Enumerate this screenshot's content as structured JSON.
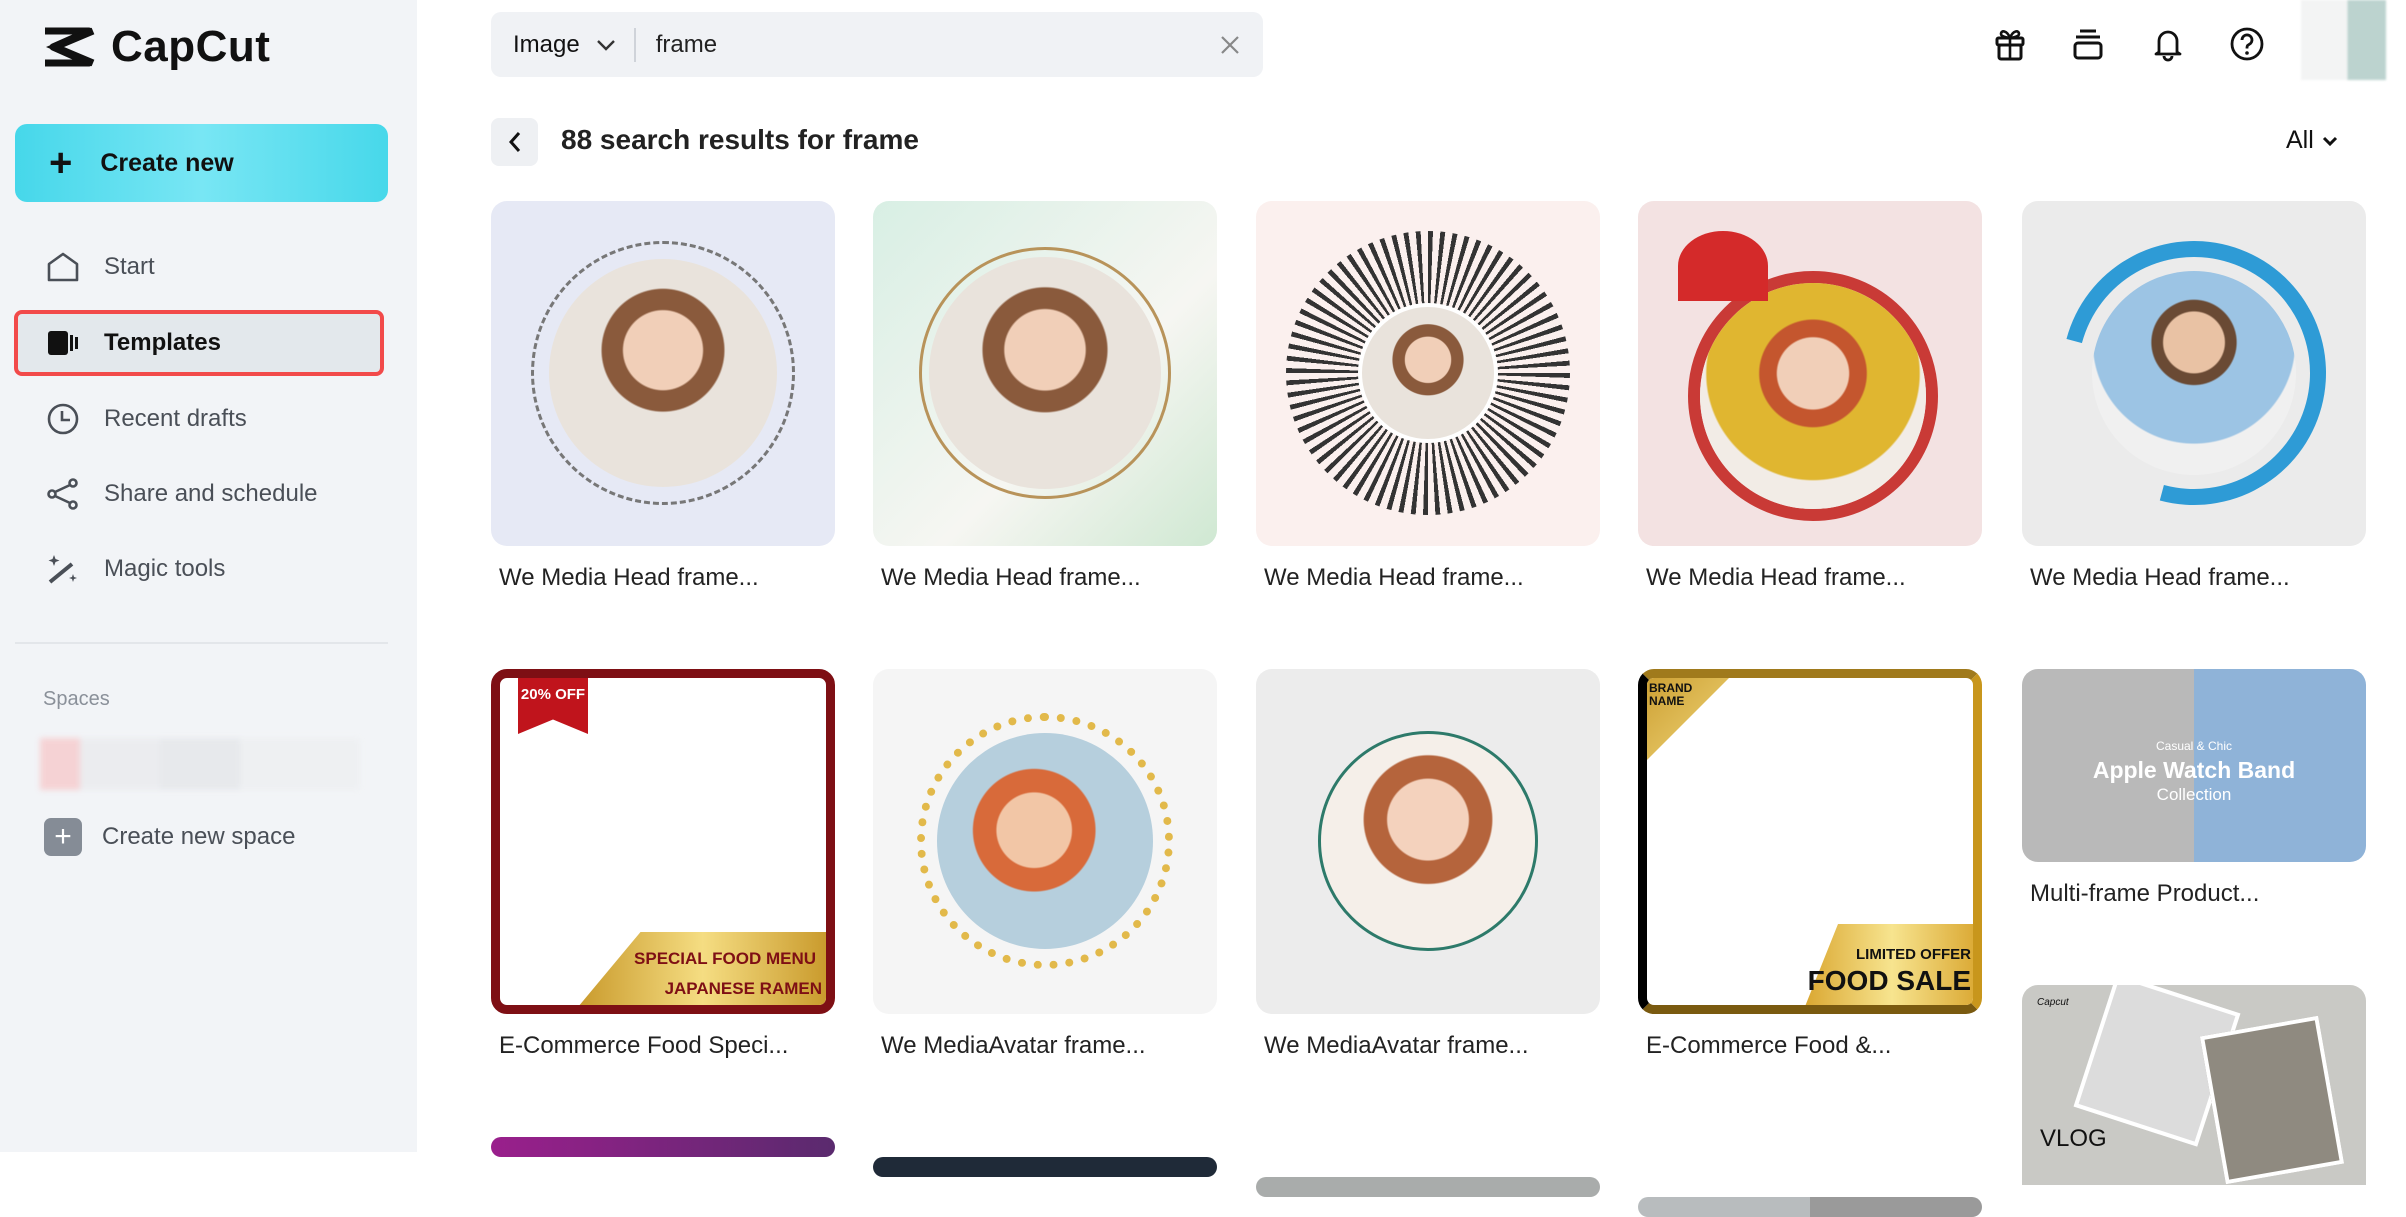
{
  "app": {
    "name": "CapCut"
  },
  "sidebar": {
    "create_label": "Create new",
    "items": [
      {
        "label": "Start",
        "icon": "home-icon"
      },
      {
        "label": "Templates",
        "icon": "templates-icon",
        "active": true
      },
      {
        "label": "Recent drafts",
        "icon": "clock-icon"
      },
      {
        "label": "Share and schedule",
        "icon": "share-icon"
      },
      {
        "label": "Magic tools",
        "icon": "magic-wand-icon"
      }
    ],
    "spaces_label": "Spaces",
    "create_space_label": "Create new space"
  },
  "header": {
    "search_type": "Image",
    "search_value": "frame",
    "icons": [
      "gift-icon",
      "inbox-icon",
      "bell-icon",
      "help-icon"
    ]
  },
  "results": {
    "title": "88 search results for frame",
    "filter": "All"
  },
  "cards": [
    {
      "caption": "We Media Head frame..."
    },
    {
      "caption": "We Media Head frame..."
    },
    {
      "caption": "We Media Head frame..."
    },
    {
      "caption": "We Media Head frame..."
    },
    {
      "caption": "We Media Head frame..."
    },
    {
      "caption": "E-Commerce Food Speci...",
      "badge": "20% OFF",
      "line1": "SPECIAL FOOD MENU",
      "line2": "JAPANESE RAMEN"
    },
    {
      "caption": "We MediaAvatar frame..."
    },
    {
      "caption": "We MediaAvatar frame..."
    },
    {
      "caption": "E-Commerce Food &...",
      "brand": "BRAND NAME",
      "line1": "LIMITED OFFER",
      "line2": "FOOD SALE"
    },
    {
      "caption": "Multi-frame Product...",
      "sub": "Casual & Chic",
      "line1": "Apple Watch Band",
      "line2": "Collection"
    },
    {
      "brand": "Capcut",
      "line1": "VLOG"
    }
  ],
  "colors": {
    "accent": "#46d7ea",
    "highlight": "#f24a4a",
    "sidebar_bg": "#f2f4f7"
  }
}
